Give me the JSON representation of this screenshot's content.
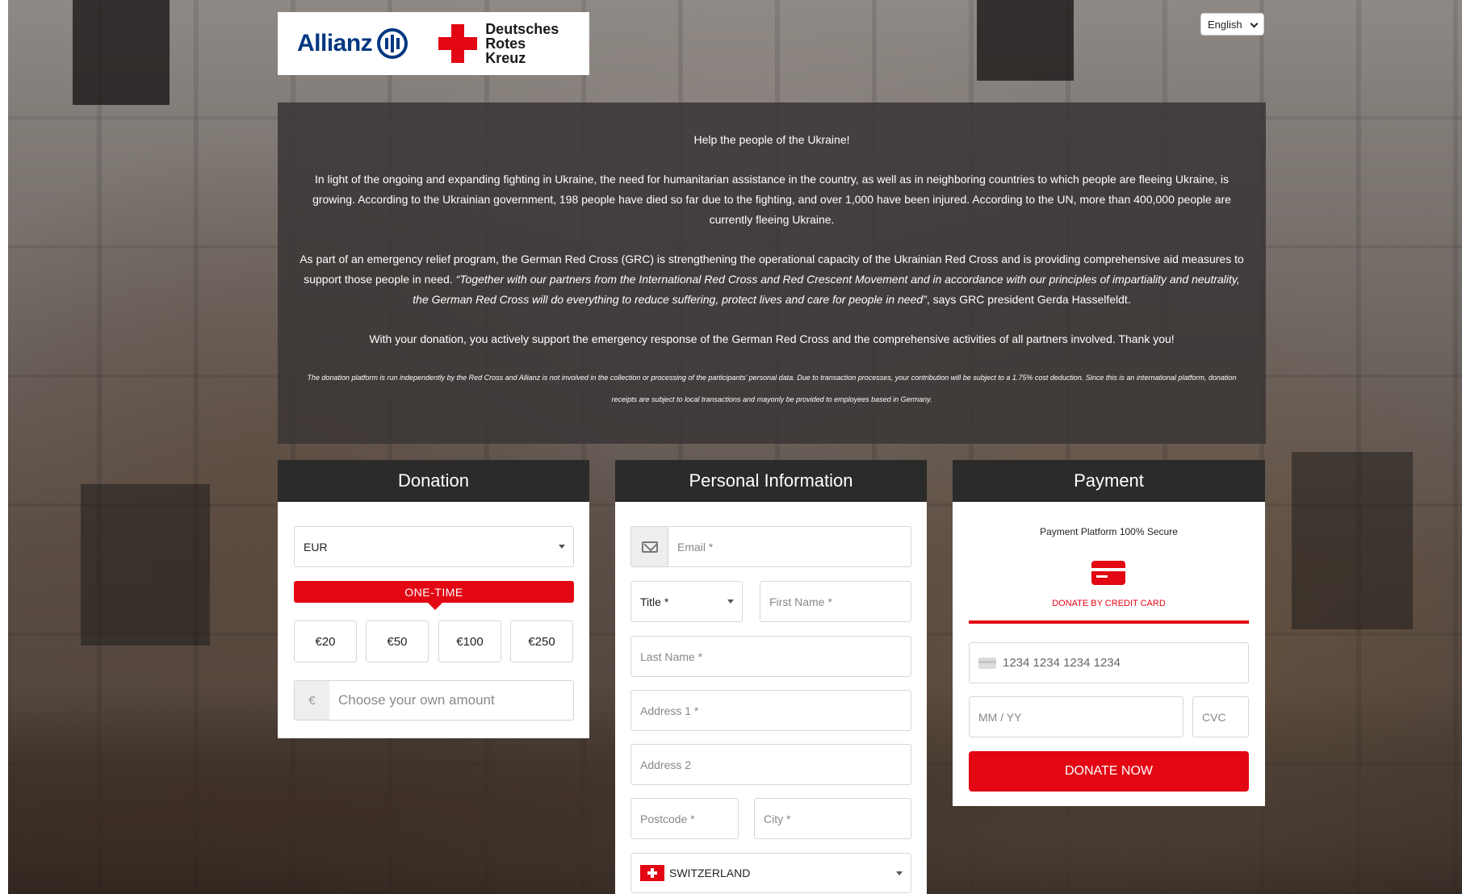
{
  "header": {
    "allianz_label": "Allianz",
    "drk_line1": "Deutsches",
    "drk_line2": "Rotes",
    "drk_line3": "Kreuz",
    "language": "English"
  },
  "info": {
    "title": "Help the people of the Ukraine!",
    "para1": "In light of the ongoing and expanding fighting in Ukraine, the need for humanitarian assistance in the country, as well as in neighboring countries to which people are fleeing Ukraine, is growing. According to the Ukrainian government, 198 people have died so far due to the fighting, and over 1,000 have been injured. According to the UN, more than 400,000 people are currently fleeing Ukraine.",
    "para2_start": "As part of an emergency relief program, the German Red Cross (GRC) is strengthening the operational capacity of the Ukrainian Red Cross and is providing comprehensive aid measures to support those people in need. ",
    "para2_quote": "“Together with our partners from the International Red Cross and Red Crescent Movement and in accordance with our principles of impartiality and neutrality, the German Red Cross will do everything to reduce suffering, protect lives and care for people in need”",
    "para2_end": ", says GRC president Gerda Hasselfeldt.",
    "para3": "With your donation, you actively support the emergency response of the German Red Cross and the comprehensive activities of all partners involved. Thank you!",
    "disclaimer": "The donation platform is run independently by the Red Cross and Allianz is not involved in the collection or processing of the participants' personal data. Due to transaction processes, your contribution will be subject to a 1.75% cost deduction. Since this is an international platform, donation receipts are subject to local transactions and mayonly be provided to employees based in Germany."
  },
  "donation": {
    "heading": "Donation",
    "currency": "EUR",
    "frequency": "ONE-TIME",
    "amounts": [
      "€20",
      "€50",
      "€100",
      "€250"
    ],
    "currency_symbol": "€",
    "own_amount_placeholder": "Choose your own amount"
  },
  "personal": {
    "heading": "Personal Information",
    "email_placeholder": "Email *",
    "title_placeholder": "Title *",
    "first_name_placeholder": "First Name *",
    "last_name_placeholder": "Last Name *",
    "address1_placeholder": "Address 1 *",
    "address2_placeholder": "Address 2",
    "postcode_placeholder": "Postcode *",
    "city_placeholder": "City *",
    "country": "SWITZERLAND"
  },
  "payment": {
    "heading": "Payment",
    "secure_text": "Payment Platform 100% Secure",
    "method_label": "DONATE BY CREDIT CARD",
    "card_number_placeholder": "1234 1234 1234 1234",
    "expiry_placeholder": "MM / YY",
    "cvc_placeholder": "CVC",
    "submit_label": "DONATE NOW"
  },
  "colors": {
    "accent": "#e30613",
    "card_header": "#2b2b2b",
    "allianz_blue": "#003781"
  },
  "icons": {
    "allianz": "allianz-logo-icon",
    "drk": "red-cross-icon",
    "email": "envelope-icon",
    "card": "credit-card-icon",
    "flag": "swiss-flag-icon"
  }
}
